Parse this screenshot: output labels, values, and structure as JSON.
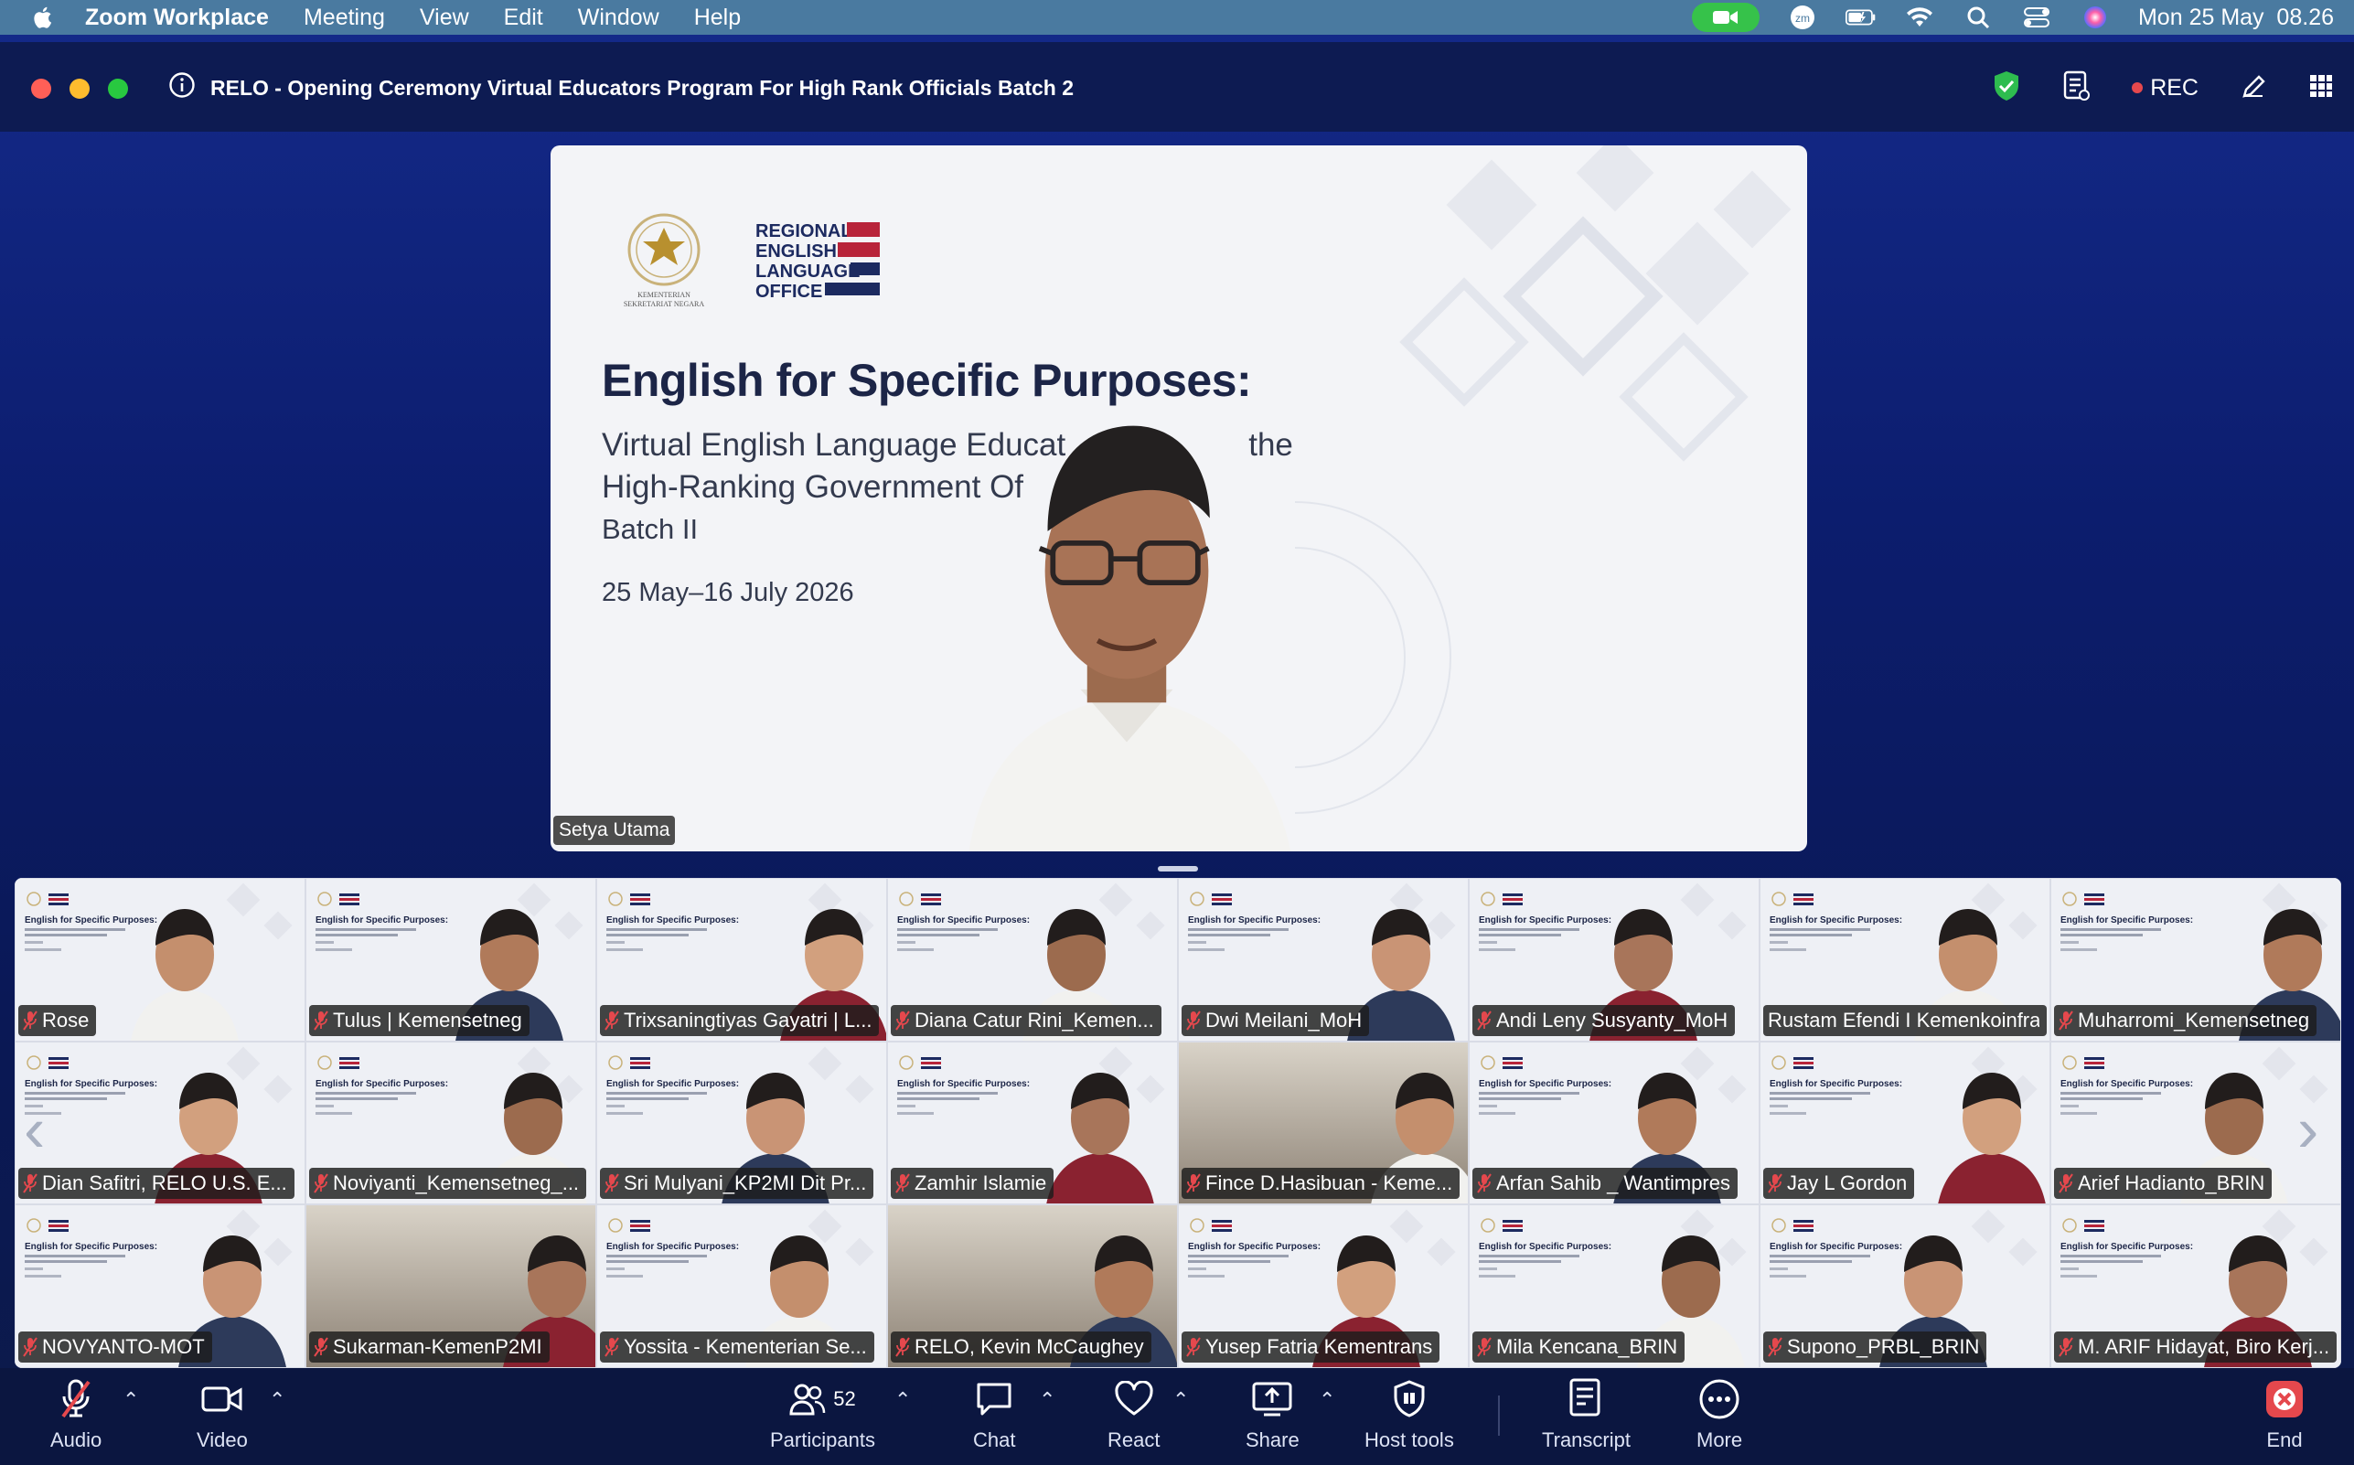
{
  "menubar": {
    "app_name": "Zoom Workplace",
    "menus": [
      "Meeting",
      "View",
      "Edit",
      "Window",
      "Help"
    ],
    "clock": "Mon 25 May  08.26",
    "zoom_badge": "zm"
  },
  "window": {
    "title": "RELO - Opening Ceremony Virtual Educators Program For High Rank Officials Batch 2",
    "rec_label": "REC"
  },
  "share": {
    "slide": {
      "logo_left_text": "KEMENTERIAN SEKRETARIAT NEGARA",
      "logo_right_lines": [
        "REGIONAL",
        "ENGLISH",
        "LANGUAGE",
        "OFFICE"
      ],
      "title": "English for Specific Purposes:",
      "subtitle_line1": "Virtual English Language Educat",
      "subtitle_line1_end": "the",
      "subtitle_line2": "High-Ranking Government Of",
      "batch": "Batch II",
      "dates": "25 May–16 July 2026"
    },
    "speaker_name": "Setya Utama"
  },
  "gallery": {
    "tiles": [
      {
        "name": "Rose",
        "muted": true,
        "bg": "slide"
      },
      {
        "name": "Tulus | Kemensetneg",
        "muted": true,
        "bg": "slide"
      },
      {
        "name": "Trixsaningtiyas Gayatri | L...",
        "muted": true,
        "bg": "slide"
      },
      {
        "name": "Diana Catur Rini_Kemen...",
        "muted": true,
        "bg": "slide"
      },
      {
        "name": "Dwi Meilani_MoH",
        "muted": true,
        "bg": "slide"
      },
      {
        "name": "Andi Leny Susyanty_MoH",
        "muted": true,
        "bg": "slide"
      },
      {
        "name": "Rustam Efendi I Kemenkoinfra",
        "muted": false,
        "bg": "slide"
      },
      {
        "name": "Muharromi_Kemensetneg",
        "muted": true,
        "bg": "slide"
      },
      {
        "name": "Dian Safitri, RELO U.S. E...",
        "muted": true,
        "bg": "slide"
      },
      {
        "name": "Noviyanti_Kemensetneg_...",
        "muted": true,
        "bg": "slide"
      },
      {
        "name": "Sri Mulyani_KP2MI Dit Pr...",
        "muted": true,
        "bg": "slide"
      },
      {
        "name": "Zamhir Islamie",
        "muted": true,
        "bg": "slide"
      },
      {
        "name": "Fince D.Hasibuan - Keme...",
        "muted": true,
        "bg": "cam"
      },
      {
        "name": "Arfan Sahib _ Wantimpres",
        "muted": true,
        "bg": "slide"
      },
      {
        "name": "Jay L Gordon",
        "muted": true,
        "bg": "slide"
      },
      {
        "name": "Arief Hadianto_BRIN",
        "muted": true,
        "bg": "slide"
      },
      {
        "name": "NOVYANTO-MOT",
        "muted": true,
        "bg": "slide"
      },
      {
        "name": "Sukarman-KemenP2MI",
        "muted": true,
        "bg": "cam"
      },
      {
        "name": "Yossita - Kementerian Se...",
        "muted": true,
        "bg": "slide"
      },
      {
        "name": "RELO, Kevin McCaughey",
        "muted": true,
        "bg": "cam"
      },
      {
        "name": "Yusep Fatria Kementrans",
        "muted": true,
        "bg": "slide"
      },
      {
        "name": "Mila Kencana_BRIN",
        "muted": true,
        "bg": "slide"
      },
      {
        "name": "Supono_PRBL_BRIN",
        "muted": true,
        "bg": "slide"
      },
      {
        "name": "M. ARIF Hidayat, Biro Kerj...",
        "muted": true,
        "bg": "slide"
      }
    ],
    "mini_slide_title": "English for Specific Purposes:"
  },
  "toolbar": {
    "audio": "Audio",
    "video": "Video",
    "participants": "Participants",
    "participants_count": "52",
    "chat": "Chat",
    "react": "React",
    "share": "Share",
    "host_tools": "Host tools",
    "transcript": "Transcript",
    "more": "More",
    "end": "End"
  },
  "colors": {
    "menubar": "#4a7aa0",
    "titlebar": "#0d1b52",
    "toolbar": "#0b1640",
    "rec_dot": "#e5484d",
    "mute_red": "#e5484d",
    "end_red": "#e5484d",
    "zoom_green": "#36c24a"
  }
}
